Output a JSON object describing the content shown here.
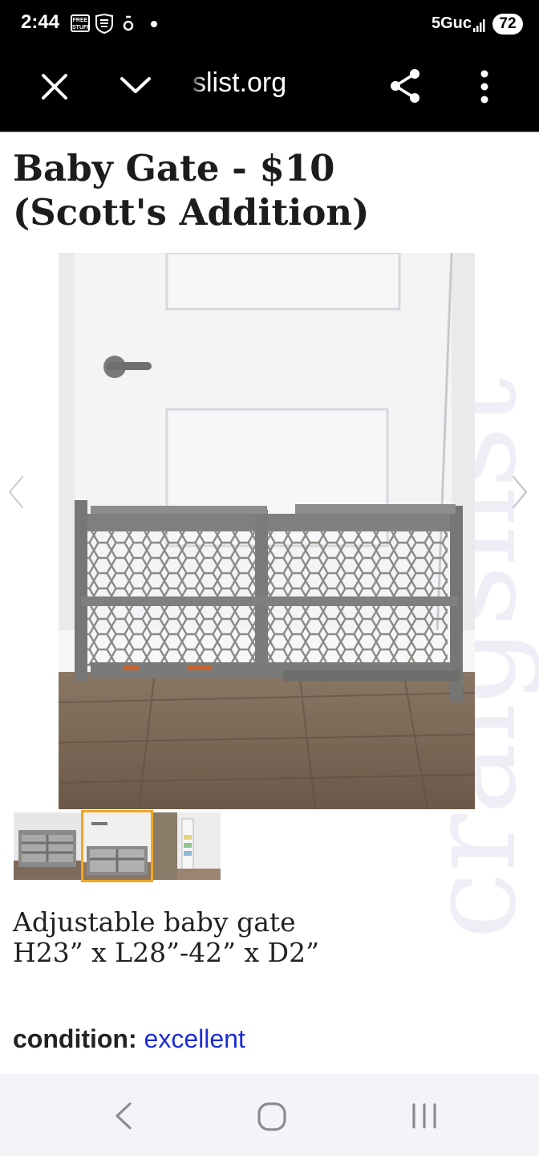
{
  "status_bar": {
    "time": "2:44",
    "free_stuff_badge": "FREE STUFF",
    "usaa_label": "USAA",
    "network": "5Guc",
    "battery": "72"
  },
  "browser_toolbar": {
    "url": "slist.org",
    "icons": [
      "close-icon",
      "chevron-down-icon",
      "share-icon",
      "more-vert-icon"
    ]
  },
  "listing": {
    "title": "Baby Gate - $10 (Scott's Addition)",
    "watermark": "craigslist",
    "description_line1": "Adjustable baby gate",
    "description_line2": "H23” x L28”-42” x D2”",
    "condition_label": "condition:",
    "condition_value": "excellent",
    "selected_thumbnail": 2
  },
  "nav_bar": {
    "icons": [
      "back-icon",
      "home-icon",
      "recents-icon"
    ]
  },
  "colors": {
    "link": "#1c2ed4",
    "thumb_highlight": "#f5a623",
    "bar_bg": "#000000"
  }
}
